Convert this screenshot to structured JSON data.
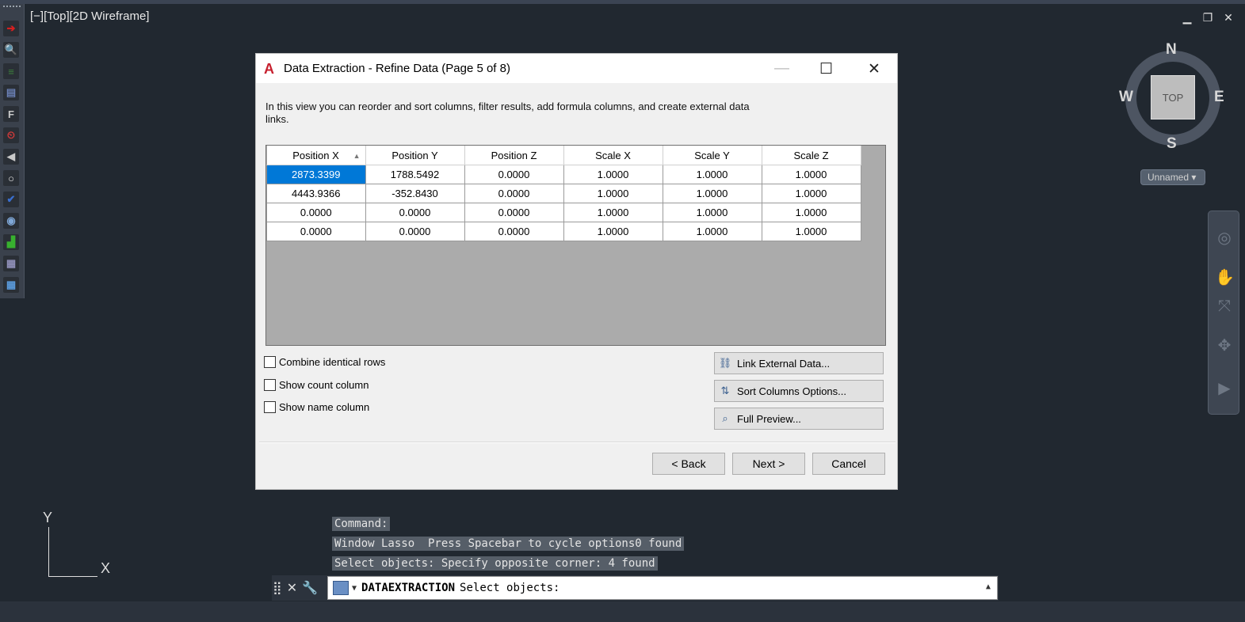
{
  "viewport": {
    "label": "[−][Top][2D Wireframe]",
    "controls": [
      "▁",
      "❐",
      "✕"
    ]
  },
  "left_toolbar": {
    "icons": [
      {
        "name": "arrow-icon",
        "glyph": "➔",
        "color": "#d62020"
      },
      {
        "name": "zoom-icon",
        "glyph": "🔍",
        "color": "#9bd3f0"
      },
      {
        "name": "layers-icon",
        "glyph": "≡",
        "color": "#3c7d3c"
      },
      {
        "name": "book-icon",
        "glyph": "▤",
        "color": "#6a7fb4"
      },
      {
        "name": "field-icon",
        "glyph": "F",
        "color": "#c8c8c8"
      },
      {
        "name": "clock-icon",
        "glyph": "⏲",
        "color": "#d23a3a"
      },
      {
        "name": "send-icon",
        "glyph": "◀",
        "color": "#c8c8c8"
      },
      {
        "name": "magnify-icon",
        "glyph": "○",
        "color": "#e6e6e6"
      },
      {
        "name": "check-icon",
        "glyph": "✔",
        "color": "#3a6fcf"
      },
      {
        "name": "camera-icon",
        "glyph": "◉",
        "color": "#7fa7d6"
      },
      {
        "name": "stairs-icon",
        "glyph": "▟",
        "color": "#38b12f"
      },
      {
        "name": "table-icon",
        "glyph": "▦",
        "color": "#8f8fb8"
      },
      {
        "name": "grid-icon",
        "glyph": "▦",
        "color": "#5a9adb"
      }
    ]
  },
  "viewcube": {
    "north": "N",
    "south": "S",
    "east": "E",
    "west": "W",
    "top_label": "TOP",
    "ucs_menu": "Unnamed ▾"
  },
  "navbar": {
    "icons": [
      "◎",
      "✋",
      "⤧",
      "✥",
      "▶"
    ]
  },
  "ucs": {
    "x": "X",
    "y": "Y"
  },
  "command": {
    "history": [
      "Command:",
      "Window Lasso  Press Spacebar to cycle options0 found",
      "Select objects: Specify opposite corner: 4 found"
    ],
    "tools": [
      "⣿",
      "✕",
      "🔧"
    ],
    "current_command": "DATAEXTRACTION",
    "prompt": "Select objects:",
    "up_arrow": "▲",
    "caret": "▼"
  },
  "dialog": {
    "logo": "A",
    "title": "Data Extraction - Refine Data (Page 5 of 8)",
    "minimize": "—",
    "maximize": "☐",
    "close": "✕",
    "description": "In this view you can reorder and sort columns, filter results, add formula columns, and create external data links.",
    "table": {
      "columns": [
        "Position X",
        "Position Y",
        "Position Z",
        "Scale X",
        "Scale Y",
        "Scale Z"
      ],
      "sort_indicator": "▲",
      "rows": [
        [
          "2873.3399",
          "1788.5492",
          "0.0000",
          "1.0000",
          "1.0000",
          "1.0000"
        ],
        [
          "4443.9366",
          "-352.8430",
          "0.0000",
          "1.0000",
          "1.0000",
          "1.0000"
        ],
        [
          "0.0000",
          "0.0000",
          "0.0000",
          "1.0000",
          "1.0000",
          "1.0000"
        ],
        [
          "0.0000",
          "0.0000",
          "0.0000",
          "1.0000",
          "1.0000",
          "1.0000"
        ]
      ]
    },
    "options": {
      "combine_identical_rows": "Combine identical rows",
      "show_count_column": "Show count column",
      "show_name_column": "Show name column"
    },
    "side_buttons": {
      "link_external": "Link External Data...",
      "sort_columns": "Sort Columns Options...",
      "full_preview": "Full Preview..."
    },
    "footer": {
      "back": "< Back",
      "next": "Next >",
      "cancel": "Cancel"
    }
  }
}
